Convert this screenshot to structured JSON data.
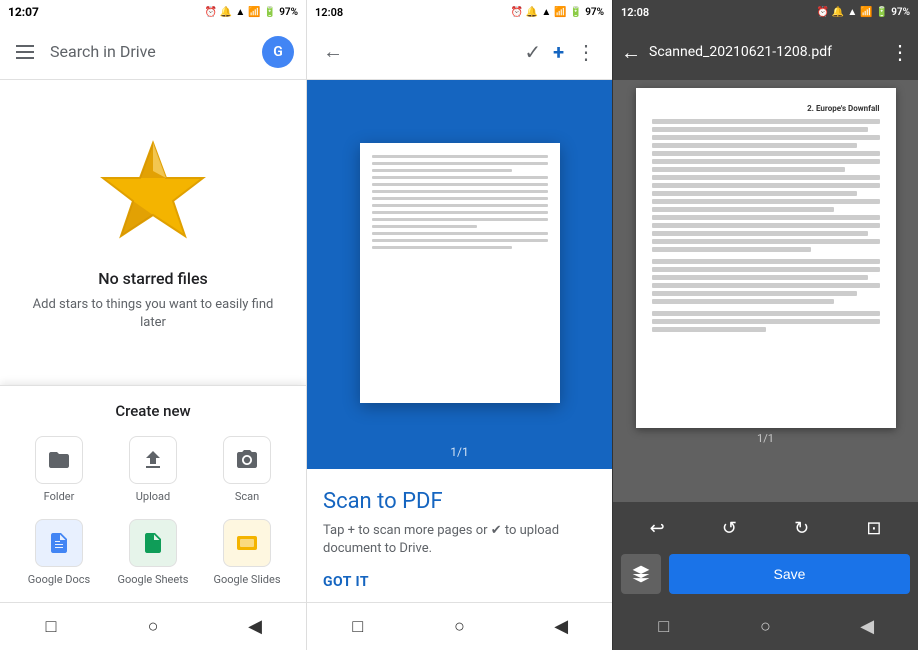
{
  "panel1": {
    "status_time": "12:07",
    "status_icons": "⏰ 🔔 97%",
    "search_placeholder": "Search in Drive",
    "starred_title": "No starred files",
    "starred_subtitle": "Add stars to things you want to easily find later",
    "create_new_title": "Create new",
    "create_items": [
      {
        "id": "folder",
        "label": "Folder",
        "color": "#5f6368",
        "icon": "📁"
      },
      {
        "id": "upload",
        "label": "Upload",
        "color": "#5f6368",
        "icon": "⬆"
      },
      {
        "id": "scan",
        "label": "Scan",
        "color": "#5f6368",
        "icon": "📷"
      },
      {
        "id": "docs",
        "label": "Google Docs",
        "color": "#4285f4",
        "icon": "📄"
      },
      {
        "id": "sheets",
        "label": "Google Sheets",
        "color": "#0f9d58",
        "icon": "📊"
      },
      {
        "id": "slides",
        "label": "Google Slides",
        "color": "#f4b400",
        "icon": "📋"
      }
    ]
  },
  "panel2": {
    "status_time": "12:08",
    "toolbar_title": "",
    "scan_to_pdf_title": "Scan to PDF",
    "scan_hint": "Tap + to scan more pages or ✔ to upload document to Drive.",
    "got_it": "GOT IT",
    "page_indicator": "1/1"
  },
  "panel3": {
    "status_time": "12:08",
    "pdf_title": "Scanned_20210621-1208.pdf",
    "chapter_heading": "2. Europe's Downfall",
    "page_count": "1/1",
    "save_label": "Save"
  }
}
